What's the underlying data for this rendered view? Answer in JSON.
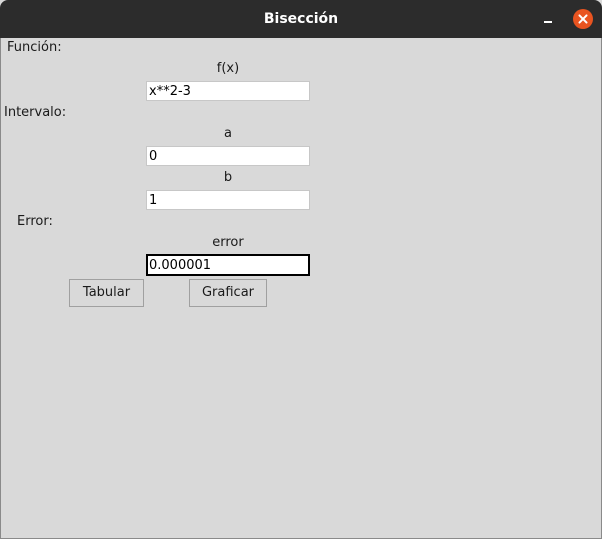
{
  "window": {
    "title": "Bisección"
  },
  "funcion": {
    "section_label": "Función:",
    "field_label": "f(x)",
    "value": "x**2-3"
  },
  "intervalo": {
    "section_label": "Intervalo:",
    "a_label": "a",
    "a_value": "0",
    "b_label": "b",
    "b_value": "1"
  },
  "error": {
    "section_label": "Error:",
    "field_label": "error",
    "value": "0.000001"
  },
  "buttons": {
    "tabular": "Tabular",
    "graficar": "Graficar"
  },
  "colors": {
    "titlebar": "#2c2c2c",
    "close_button": "#e95420",
    "background": "#d9d9d9"
  },
  "icons": {
    "minimize": "minimize-icon",
    "close": "close-icon"
  }
}
